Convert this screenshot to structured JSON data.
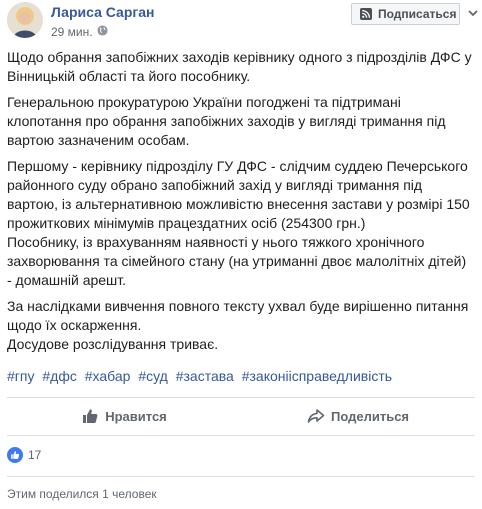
{
  "post": {
    "author": "Лариса Сарган",
    "time": "29 мин.",
    "subscribe_label": "Подписаться",
    "paragraphs": [
      [
        "Щодо обрання запобіжних заходів керівнику одного з підрозділів ДФС у",
        "Вінницькій області та його пособнику."
      ],
      [
        "Генеральною прокуратурою України погоджені та підтримані",
        "клопотання про обрання запобіжних заходів у вигляді тримання під",
        "вартою зазначеним особам."
      ],
      [
        "Першому - керівнику підрозділу ГУ ДФС - слідчим суддею Печерського",
        "районного суду обрано запобіжний захід у вигляді тримання під",
        "вартою, із альтернативною можливістю внесення застави у розмірі 150",
        "прожиткових мінімумів працездатних осіб (254300 грн.)",
        "Пособнику, із врахуванням наявності у нього тяжкого хронічного",
        "захворювання та сімейного стану (на утриманні двоє малолітніх дітей)",
        "- домашній арешт."
      ],
      [
        "За наслідками вивчення повного тексту ухвал буде вирішенно питання",
        "щодо їх оскарження.",
        "Досудове розслідування триває."
      ]
    ],
    "hashtags": [
      "#гпу",
      "#дфс",
      "#хабар",
      "#суд",
      "#застава",
      "#законіісправедливість"
    ]
  },
  "actions": {
    "like_label": "Нравится",
    "share_label": "Поделиться"
  },
  "reactions": {
    "count": "17"
  },
  "shares": {
    "text": "Этим поделился 1 человек"
  },
  "icons": {
    "globe": "globe-icon",
    "subscribe": "rss-icon",
    "more": "chevron-down-icon",
    "like": "thumbs-up-icon",
    "share": "share-arrow-icon",
    "reaction": "like-reaction-icon"
  },
  "colors": {
    "author": "#385898",
    "hashtag": "#365899",
    "like_badge": "#3f7af0"
  }
}
